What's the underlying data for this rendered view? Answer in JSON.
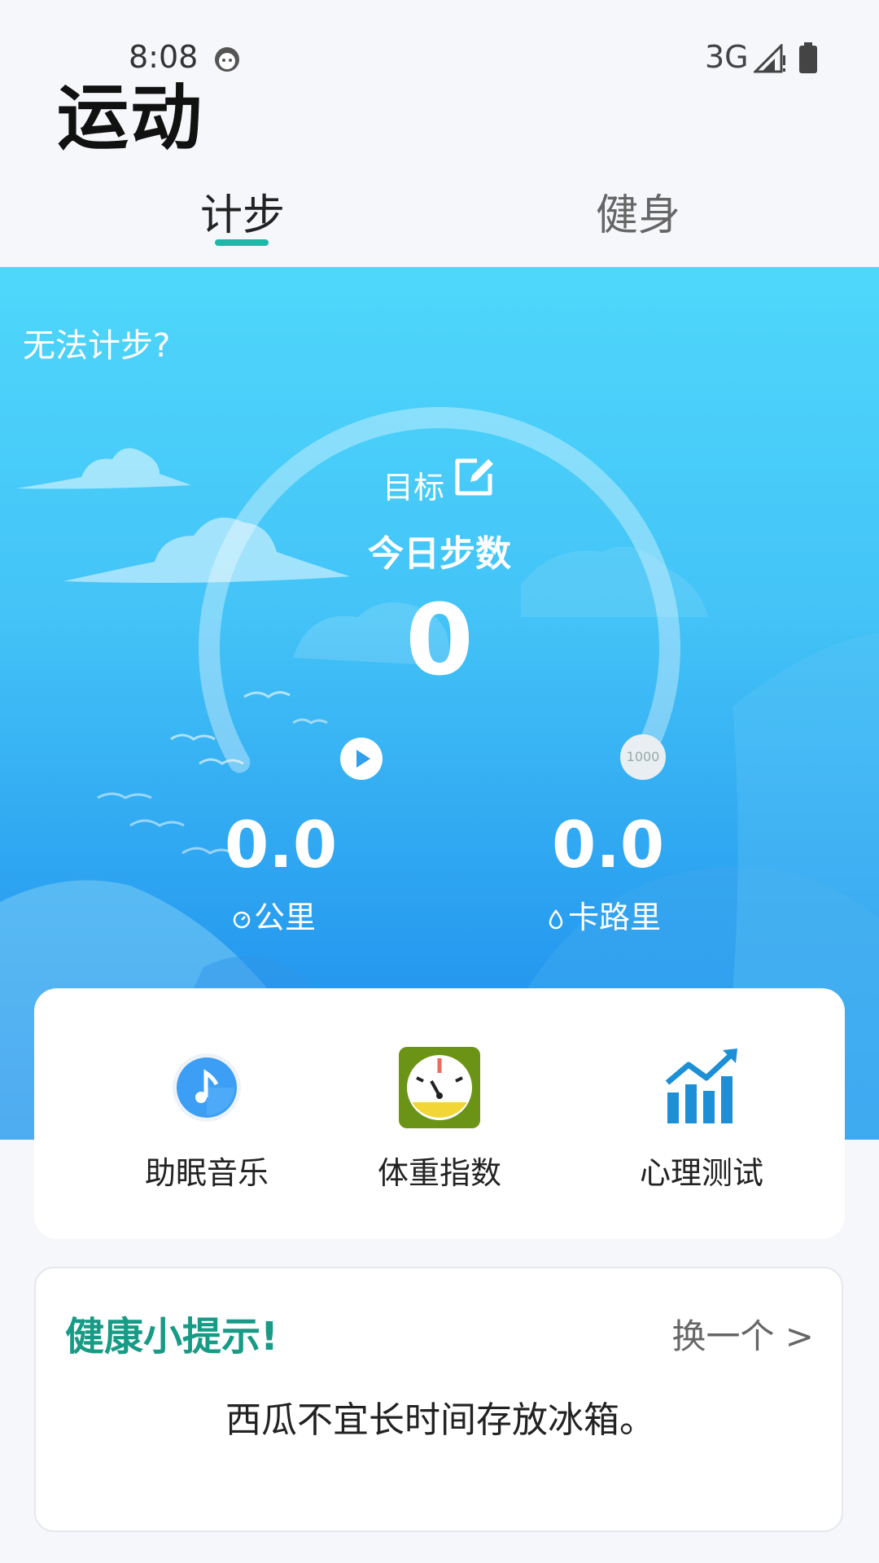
{
  "status_bar": {
    "time": "8:08",
    "network": "3G"
  },
  "header": {
    "title": "运动"
  },
  "tabs": [
    {
      "label": "计步",
      "active": true
    },
    {
      "label": "健身",
      "active": false
    }
  ],
  "hero": {
    "cant_count_link": "无法计步?",
    "target_label": "目标",
    "today_steps_label": "今日步数",
    "steps_value": "0",
    "goal_value": "1000",
    "distance": {
      "value": "0.0",
      "unit": "公里"
    },
    "calories": {
      "value": "0.0",
      "unit": "卡路里"
    }
  },
  "quick_actions": [
    {
      "label": "助眠音乐",
      "icon": "music-note-icon"
    },
    {
      "label": "体重指数",
      "icon": "scale-icon"
    },
    {
      "label": "心理测试",
      "icon": "bar-chart-icon"
    }
  ],
  "tip": {
    "title": "健康小提示!",
    "refresh_label": "换一个 >",
    "text": "西瓜不宜长时间存放冰箱。"
  },
  "colors": {
    "accent": "#1fb8a8",
    "tip_title": "#179b86",
    "hero_top": "#4fd7fb",
    "hero_bottom": "#1a88ec"
  }
}
